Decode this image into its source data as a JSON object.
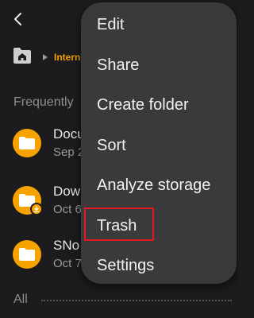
{
  "header": {
    "back_icon": "back-arrow-icon"
  },
  "breadcrumb": {
    "home_icon": "home-folder-icon",
    "path": "Intern"
  },
  "section": {
    "frequently_title": "Frequently",
    "all_title": "All"
  },
  "files": [
    {
      "name": "Docu",
      "date": "Sep 2",
      "icon": "folder-icon"
    },
    {
      "name": "Dow",
      "date": "Oct 6",
      "icon": "folder-icon",
      "badge": "download-badge-icon"
    },
    {
      "name": "SNo",
      "date": "Oct 7",
      "icon": "folder-icon"
    }
  ],
  "menu": {
    "items": [
      {
        "label": "Edit"
      },
      {
        "label": "Share"
      },
      {
        "label": "Create folder"
      },
      {
        "label": "Sort"
      },
      {
        "label": "Analyze storage"
      },
      {
        "label": "Trash",
        "highlighted": true
      },
      {
        "label": "Settings"
      }
    ]
  },
  "colors": {
    "background": "#1c1c1e",
    "accent": "#f6a300",
    "menu_bg": "#3a3a3c",
    "highlight_border": "#e01b24"
  }
}
